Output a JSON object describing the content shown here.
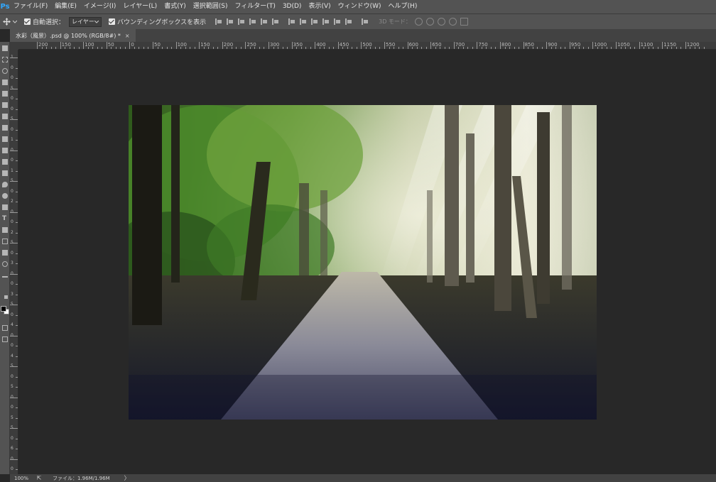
{
  "app": {
    "logo": "Ps"
  },
  "menu": [
    {
      "label": "ファイル(F)"
    },
    {
      "label": "編集(E)"
    },
    {
      "label": "イメージ(I)"
    },
    {
      "label": "レイヤー(L)"
    },
    {
      "label": "書式(Y)"
    },
    {
      "label": "選択範囲(S)"
    },
    {
      "label": "フィルター(T)"
    },
    {
      "label": "3D(D)"
    },
    {
      "label": "表示(V)"
    },
    {
      "label": "ウィンドウ(W)"
    },
    {
      "label": "ヘルプ(H)"
    }
  ],
  "options": {
    "auto_select_label": "自動選択：",
    "auto_select_value": "レイヤー",
    "bounding_box_label": "バウンディングボックスを表示",
    "mode_3d_label": "3D モード："
  },
  "document": {
    "tab_title": "水彩（風景）.psd @ 100% (RGB/8#) *",
    "close_glyph": "×"
  },
  "ruler": {
    "h_labels": [
      "200",
      "150",
      "100",
      "50",
      "0",
      "50",
      "100",
      "150",
      "200",
      "250",
      "300",
      "350",
      "400",
      "450",
      "500",
      "550",
      "600",
      "650",
      "700",
      "750",
      "800",
      "850",
      "900",
      "950",
      "1000",
      "1050",
      "1100",
      "1150",
      "1200"
    ],
    "v_labels": [
      "1",
      "0",
      "0",
      "5",
      "0",
      "0",
      "5",
      "0",
      "1",
      "0",
      "0",
      "1",
      "5",
      "0",
      "2",
      "0",
      "0",
      "2",
      "5",
      "0",
      "3",
      "0",
      "0",
      "3",
      "5",
      "0",
      "4",
      "0",
      "0",
      "4",
      "5",
      "0",
      "5",
      "0",
      "0",
      "5",
      "5",
      "0",
      "6",
      "0",
      "0"
    ]
  },
  "status": {
    "zoom": "100%",
    "file_info": "ファイル：1.96M/1.96M",
    "arrow": "〉"
  },
  "icons": {
    "move_tool": "move-tool-icon",
    "share": "share-icon"
  }
}
